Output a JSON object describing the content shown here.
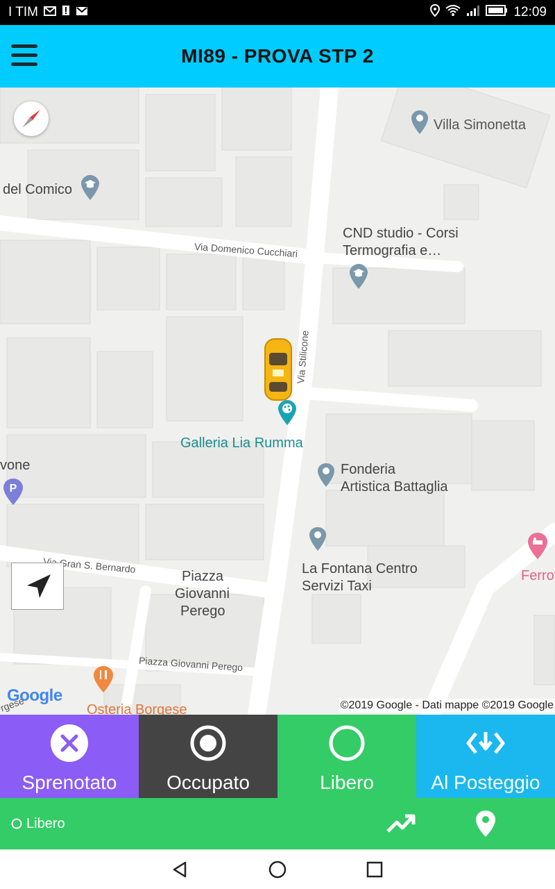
{
  "status_bar": {
    "carrier": "I TIM",
    "time": "12:09"
  },
  "app_bar": {
    "title": "MI89 - PROVA STP 2",
    "menu_icon": "hamburger-menu-icon"
  },
  "map": {
    "pois": {
      "villa_simonetta": "Villa Simonetta",
      "del_comico": "del Comico",
      "cnd_line1": "CND studio - Corsi",
      "cnd_line2": "Termografia e…",
      "galleria": "Galleria Lia Rumma",
      "fonderia_line1": "Fonderia",
      "fonderia_line2": "Artistica Battaglia",
      "vone": "vone",
      "fontana_line1": "La Fontana Centro",
      "fontana_line2": "Servizi Taxi",
      "ferro": "Ferrot",
      "piazza_line1": "Piazza",
      "piazza_line2": "Giovanni",
      "piazza_line3": "Perego",
      "osteria": "Osteria Borgese"
    },
    "streets": {
      "cucchiari": "Via Domenico Cucchiari",
      "stilicone": "Via Stilicone",
      "gran_bernardo": "Via Gran S. Bernardo",
      "piazza_perego": "Piazza Giovanni Perego",
      "borgese": "rgese"
    },
    "google_logo": "Google",
    "copyright": "©2019 Google - Dati mappe ©2019 Google"
  },
  "status_buttons": [
    {
      "label": "Sprenotato",
      "color": "#8b5cf6"
    },
    {
      "label": "Occupato",
      "color": "#444444"
    },
    {
      "label": "Libero",
      "color": "#33cc66"
    },
    {
      "label": "Al Posteggio",
      "color": "#1ab8ee"
    }
  ],
  "bottom_bar": {
    "current_status": "Libero"
  },
  "colors": {
    "appbar": "#00ccff",
    "green": "#33cc66",
    "purple": "#8b5cf6",
    "dark": "#444444",
    "blue": "#1ab8ee"
  }
}
